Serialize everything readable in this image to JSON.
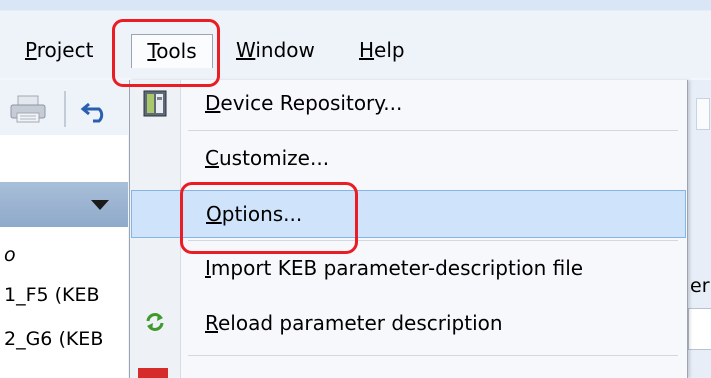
{
  "menubar": {
    "items": [
      {
        "pre": "",
        "accel": "P",
        "post": "roject"
      },
      {
        "pre": "",
        "accel": "T",
        "post": "ools"
      },
      {
        "pre": "",
        "accel": "W",
        "post": "indow"
      },
      {
        "pre": "",
        "accel": "H",
        "post": "elp"
      }
    ]
  },
  "tools_menu": {
    "items": [
      {
        "pre": "",
        "accel": "D",
        "post": "evice Repository..."
      },
      {
        "pre": "",
        "accel": "C",
        "post": "ustomize..."
      },
      {
        "pre": "",
        "accel": "O",
        "post": "ptions..."
      },
      {
        "pre": "",
        "accel": "I",
        "post": "mport KEB parameter-description file"
      },
      {
        "pre": "",
        "accel": "R",
        "post": "eload parameter description"
      }
    ],
    "highlighted_item": "Options..."
  },
  "left_pane": {
    "lines": [
      "o",
      "1_F5 (KEB",
      "2_G6 (KEB"
    ]
  },
  "right_fragment": "er",
  "colors": {
    "annotation_red": "#ea1c24",
    "highlight_bg": "#cfe4fb",
    "highlight_border": "#85b5e6",
    "pane_header": "#a9bfd9"
  },
  "icons": [
    "printer-icon",
    "undo-icon",
    "chevron-down-icon",
    "device-repository-icon",
    "reload-icon"
  ]
}
